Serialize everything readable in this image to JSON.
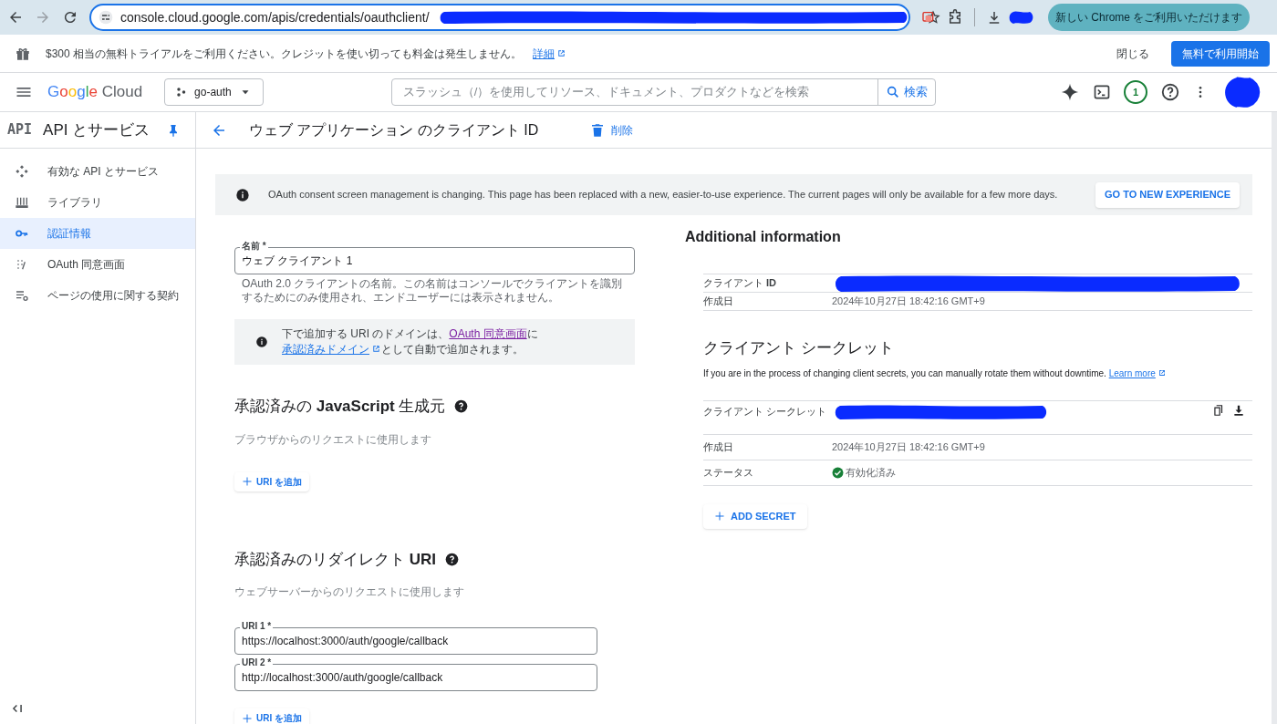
{
  "browser": {
    "url": "console.cloud.google.com/apis/credentials/oauthclient/",
    "update_button": "新しい Chrome をご利用いただけます"
  },
  "banner": {
    "text": "$300 相当の無料トライアルをご利用ください。クレジットを使い切っても料金は発生しません。",
    "link": "詳細",
    "close": "閉じる",
    "cta": "無料で利用開始"
  },
  "header": {
    "logo": "Google Cloud",
    "project": "go-auth",
    "search_placeholder": "スラッシュ（/）を使用してリソース、ドキュメント、プロダクトなどを検索",
    "search_button": "検索",
    "notifications": "1"
  },
  "sidebar": {
    "badge": "API",
    "title": "API とサービス",
    "items": [
      {
        "label": "有効な API とサービス",
        "selected": false
      },
      {
        "label": "ライブラリ",
        "selected": false
      },
      {
        "label": "認証情報",
        "selected": true
      },
      {
        "label": "OAuth 同意画面",
        "selected": false
      },
      {
        "label": "ページの使用に関する契約",
        "selected": false
      }
    ]
  },
  "page": {
    "title": "ウェブ アプリケーション のクライアント ID",
    "delete": "削除"
  },
  "notice": {
    "text": "OAuth consent screen management is changing. This page has been replaced with a new, easier-to-use experience. The current pages will only be available for a few more days.",
    "button": "GO TO NEW EXPERIENCE"
  },
  "name_field": {
    "label": "名前 *",
    "value": "ウェブ クライアント 1",
    "helper": "OAuth 2.0 クライアントの名前。この名前はコンソールでクライアントを識別するためにのみ使用され、エンドユーザーには表示されません。"
  },
  "domain_info": [
    {
      "kind": "text",
      "text": "下で追加する URI のドメインは、"
    },
    {
      "kind": "link",
      "text": "OAuth 同意画面",
      "visited": true
    },
    {
      "kind": "text",
      "text": "に"
    },
    {
      "kind": "link",
      "text": "承認済みドメイン",
      "visited": false,
      "external": true
    },
    {
      "kind": "text",
      "text": "として自動で追加されます。"
    }
  ],
  "sections": [
    {
      "title": "承認済みの **JavaScript** 生成元",
      "subtitle": "ブラウザからのリクエストに使用します",
      "add_button": "URI を追加"
    },
    {
      "title": "承認済みのリダイレクト **URI**",
      "subtitle": "ウェブサーバーからのリクエストに使用します",
      "uris": [
        {
          "label": "URI 1 *",
          "value": "https://localhost:3000/auth/google/callback"
        },
        {
          "label": "URI 2 *",
          "value": "http://localhost:3000/auth/google/callback"
        }
      ],
      "add_button": "URI を追加"
    }
  ],
  "additional": {
    "heading": "Additional information",
    "rows": [
      {
        "kind": "redacted",
        "label": "クライアント **ID**"
      },
      {
        "kind": "plain",
        "label": "作成日",
        "value": "2024年10月27日 18:42:16 GMT+9"
      }
    ]
  },
  "secret": {
    "title": "クライアント シークレット",
    "description": "If you are in the process of changing client secrets, you can manually rotate them without downtime.",
    "link": "Learn more",
    "rows": [
      {
        "kind": "secret",
        "label": "クライアント シークレット"
      },
      {
        "kind": "plain",
        "label": "作成日",
        "value": "2024年10月27日 18:42:16 GMT+9"
      },
      {
        "kind": "status",
        "label": "ステータス",
        "value": "有効化済み",
        "enabled": true
      }
    ],
    "add_button": "ADD SECRET"
  }
}
